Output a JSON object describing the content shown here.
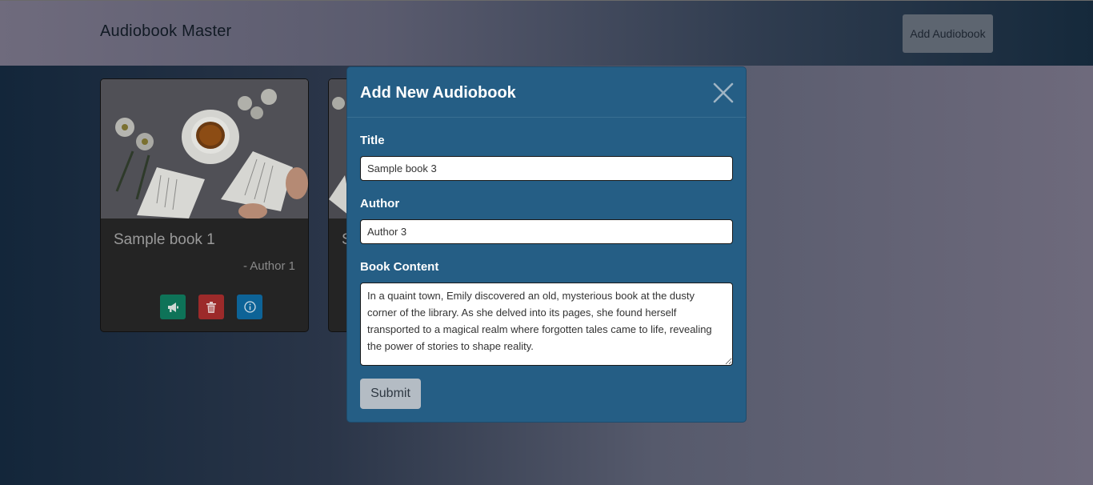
{
  "navbar": {
    "brand": "Audiobook Master",
    "add_button_label": "Add Audiobook"
  },
  "cards": [
    {
      "title": "Sample book 1",
      "author": "- Author 1"
    },
    {
      "title": "S",
      "author": ""
    }
  ],
  "card_actions": {
    "play_icon": "megaphone-icon",
    "delete_icon": "trash-icon",
    "info_icon": "info-icon"
  },
  "modal": {
    "title": "Add New Audiobook",
    "fields": {
      "title_label": "Title",
      "title_value": "Sample book 3",
      "author_label": "Author",
      "author_value": "Author 3",
      "content_label": "Book Content",
      "content_value": "In a quaint town, Emily discovered an old, mysterious book at the dusty corner of the library. As she delved into its pages, she found herself transported to a magical realm where forgotten tales came to life, revealing the power of stories to shape reality."
    },
    "submit_label": "Submit"
  },
  "colors": {
    "modal_bg": "#255e85",
    "play_button": "#0e7358",
    "delete_button": "#9c2a2a",
    "info_button": "#0d6397"
  }
}
